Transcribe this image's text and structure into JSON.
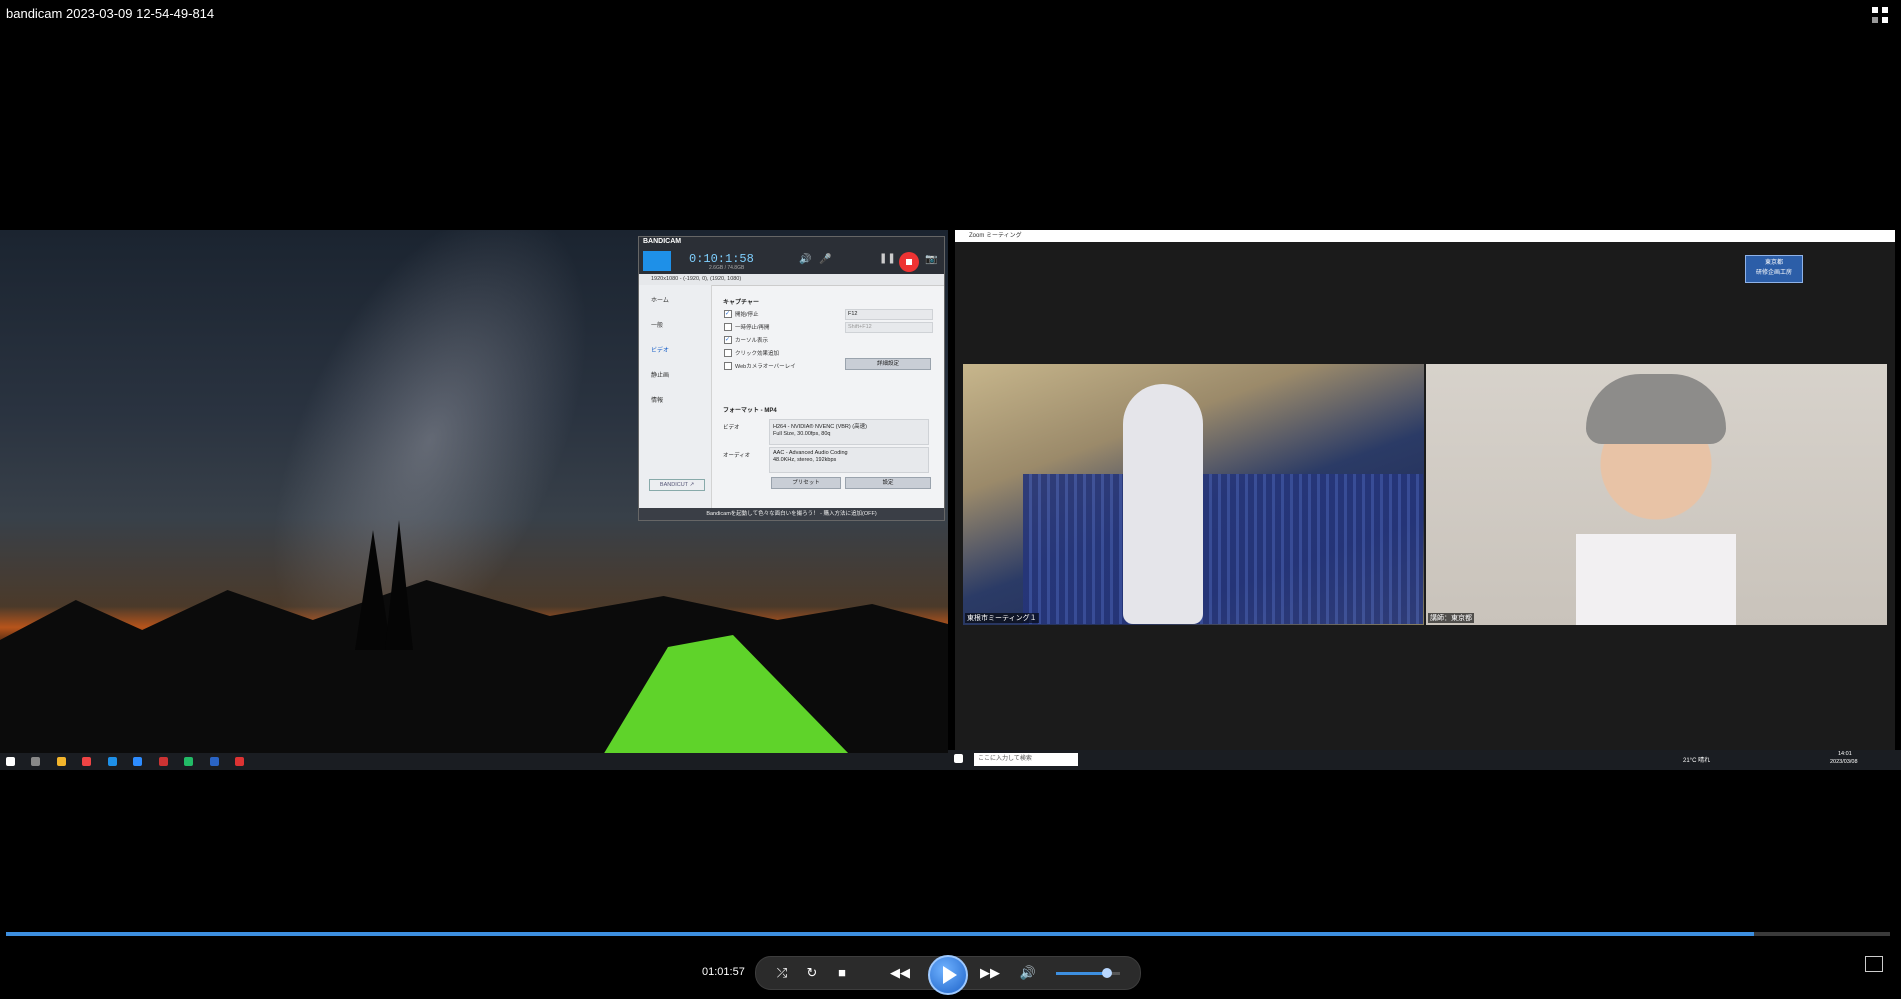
{
  "window": {
    "title": "bandicam 2023-03-09 12-54-49-814"
  },
  "bandicam": {
    "logo": "BANDICAM",
    "timer": "0:10:1:58",
    "size": "2.6GB / 74.8GB",
    "resolution": "1920x1080 - (-1920, 0), (1920, 1080)",
    "sidebar": [
      "ホーム",
      "一般",
      "ビデオ",
      "静止画",
      "情報"
    ],
    "section_capture": "キャプチャー",
    "options": [
      {
        "label": "開始/停止",
        "checked": true
      },
      {
        "label": "一時停止/再開",
        "checked": false
      },
      {
        "label": "カーソル表示",
        "checked": true
      },
      {
        "label": "クリック効果追加",
        "checked": false
      },
      {
        "label": "Webカメラオーバーレイ",
        "checked": false
      }
    ],
    "hotkey": "F12",
    "hotkey2": "Shift+F12",
    "advanced_btn": "詳細設定",
    "format_label": "フォーマット - MP4",
    "video_label": "ビデオ",
    "video_codec": "H264 - NVIDIA® NVENC (VBR) (高速)",
    "video_detail": "Full Size, 30.00fps, 80q",
    "audio_label": "オーディオ",
    "audio_codec": "AAC - Advanced Audio Coding",
    "audio_detail": "48.0KHz, stereo, 192kbps",
    "preset_btn": "プリセット",
    "settings_btn": "設定",
    "bandicut": "BANDICUT ↗",
    "footer": "Bandicamを起動して色々な面白いを撮ろう！ - 購入方法に追加(OFF)"
  },
  "zoom": {
    "title": "Zoom ミーティング",
    "tag_line1": "東京都",
    "tag_line2": "研修企画工房",
    "participant1": "東根市ミーティング１",
    "participant2": "講師：東京都"
  },
  "taskbar": {
    "search": "ここに入力して検索",
    "weather": "21°C 晴れ",
    "clock_time": "14:01",
    "clock_date": "2023/03/08"
  },
  "player": {
    "position": "01:01:57",
    "progress": 0.928,
    "volume": 0.8
  }
}
